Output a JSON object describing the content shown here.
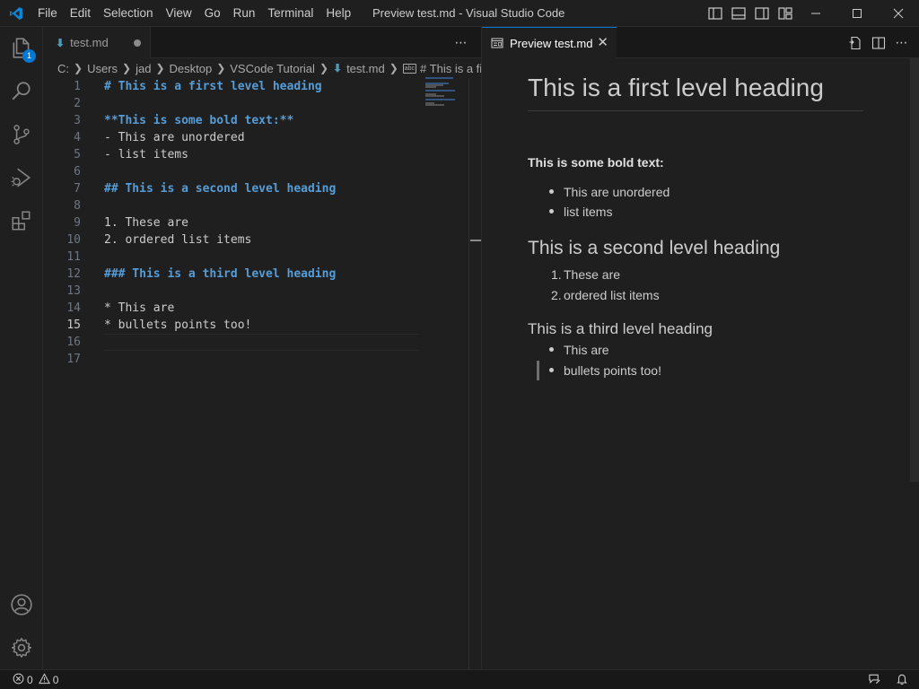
{
  "app": {
    "window_title": "Preview test.md - Visual Studio Code",
    "accent_color": "#0078d4"
  },
  "menu": [
    "File",
    "Edit",
    "Selection",
    "View",
    "Go",
    "Run",
    "Terminal",
    "Help"
  ],
  "activity_bar": {
    "items": [
      "explorer-icon",
      "search-icon",
      "source-control-icon",
      "run-debug-icon",
      "extensions-icon"
    ],
    "explorer_badge": "1",
    "bottom_items": [
      "accounts-icon",
      "manage-gear-icon"
    ]
  },
  "editor_left": {
    "tab_label": "test.md",
    "tab_dirty": true,
    "breadcrumb": [
      "C:",
      "Users",
      "jad",
      "Desktop",
      "VSCode Tutorial",
      "test.md",
      "# This is a first le"
    ],
    "active_line": 15,
    "lines": [
      {
        "n": "1",
        "text": "# This is a first level heading"
      },
      {
        "n": "2",
        "text": ""
      },
      {
        "n": "3",
        "text": "**This is some bold text:**"
      },
      {
        "n": "4",
        "text": "- This are unordered"
      },
      {
        "n": "5",
        "text": "- list items"
      },
      {
        "n": "6",
        "text": ""
      },
      {
        "n": "7",
        "text": "## This is a second level heading"
      },
      {
        "n": "8",
        "text": ""
      },
      {
        "n": "9",
        "text": "1. These are"
      },
      {
        "n": "10",
        "text": "2. ordered list items"
      },
      {
        "n": "11",
        "text": ""
      },
      {
        "n": "12",
        "text": "### This is a third level heading"
      },
      {
        "n": "13",
        "text": ""
      },
      {
        "n": "14",
        "text": "* This are"
      },
      {
        "n": "15",
        "text": "* bullets points too!"
      },
      {
        "n": "16",
        "text": ""
      },
      {
        "n": "17",
        "text": ""
      }
    ]
  },
  "preview": {
    "tab_label": "Preview test.md",
    "h1": "This is a first level heading",
    "bold": "This is some bold text:",
    "unordered": [
      "This are unordered",
      "list items"
    ],
    "h2": "This is a second level heading",
    "ordered": [
      "These are",
      "ordered list items"
    ],
    "h3": "This is a third level heading",
    "bullets": [
      "This are",
      "bullets points too!"
    ]
  },
  "status_bar": {
    "errors": "0",
    "warnings": "0"
  }
}
